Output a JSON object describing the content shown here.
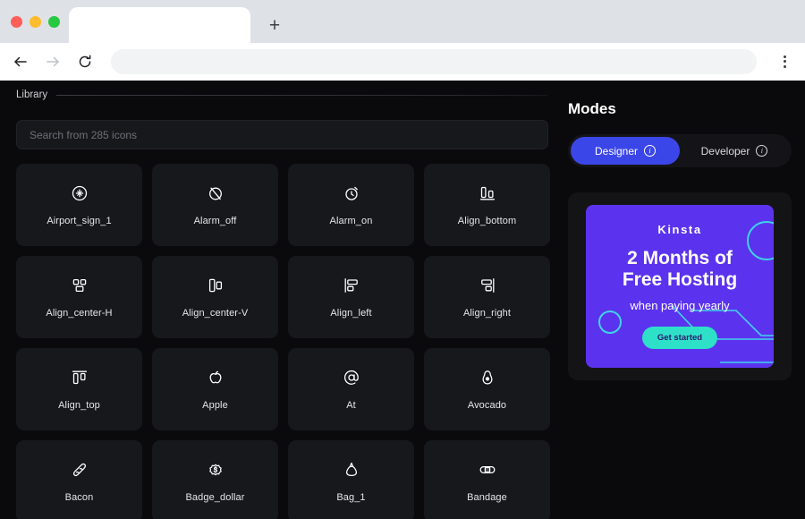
{
  "browser": {
    "traffic_lights": [
      "close",
      "minimize",
      "maximize"
    ],
    "new_tab_label": "+",
    "tab_title": "",
    "url_value": "",
    "url_placeholder": "",
    "back_label": "←",
    "forward_label": "→",
    "reload_label": "⟳"
  },
  "library": {
    "title": "Library",
    "search_placeholder": "Search from 285 icons",
    "search_value": "",
    "icons": [
      {
        "name": "Airport_sign_1",
        "icon": "airport-sign-icon"
      },
      {
        "name": "Alarm_off",
        "icon": "alarm-off-icon"
      },
      {
        "name": "Alarm_on",
        "icon": "alarm-on-icon"
      },
      {
        "name": "Align_bottom",
        "icon": "align-bottom-icon"
      },
      {
        "name": "Align_center-H",
        "icon": "align-center-horizontal-icon"
      },
      {
        "name": "Align_center-V",
        "icon": "align-center-vertical-icon"
      },
      {
        "name": "Align_left",
        "icon": "align-left-icon"
      },
      {
        "name": "Align_right",
        "icon": "align-right-icon"
      },
      {
        "name": "Align_top",
        "icon": "align-top-icon"
      },
      {
        "name": "Apple",
        "icon": "apple-icon"
      },
      {
        "name": "At",
        "icon": "at-icon"
      },
      {
        "name": "Avocado",
        "icon": "avocado-icon"
      },
      {
        "name": "Bacon",
        "icon": "bacon-icon"
      },
      {
        "name": "Badge_dollar",
        "icon": "badge-dollar-icon"
      },
      {
        "name": "Bag_1",
        "icon": "bag-icon"
      },
      {
        "name": "Bandage",
        "icon": "bandage-icon"
      }
    ]
  },
  "modes": {
    "title": "Modes",
    "options": [
      {
        "label": "Designer",
        "active": true,
        "info": "i"
      },
      {
        "label": "Developer",
        "active": false,
        "info": "i"
      }
    ]
  },
  "ad": {
    "brand": "Kinsta",
    "headline_line1": "2 Months of",
    "headline_line2": "Free Hosting",
    "subline": "when paying yearly",
    "cta": "Get started"
  },
  "colors": {
    "page_bg": "#0a0a0c",
    "card_bg": "#16181c",
    "accent_blue": "#3b46e8",
    "ad_purple": "#5b33ee",
    "ad_teal": "#2ee0c8",
    "ad_line": "#3fd3ea"
  }
}
